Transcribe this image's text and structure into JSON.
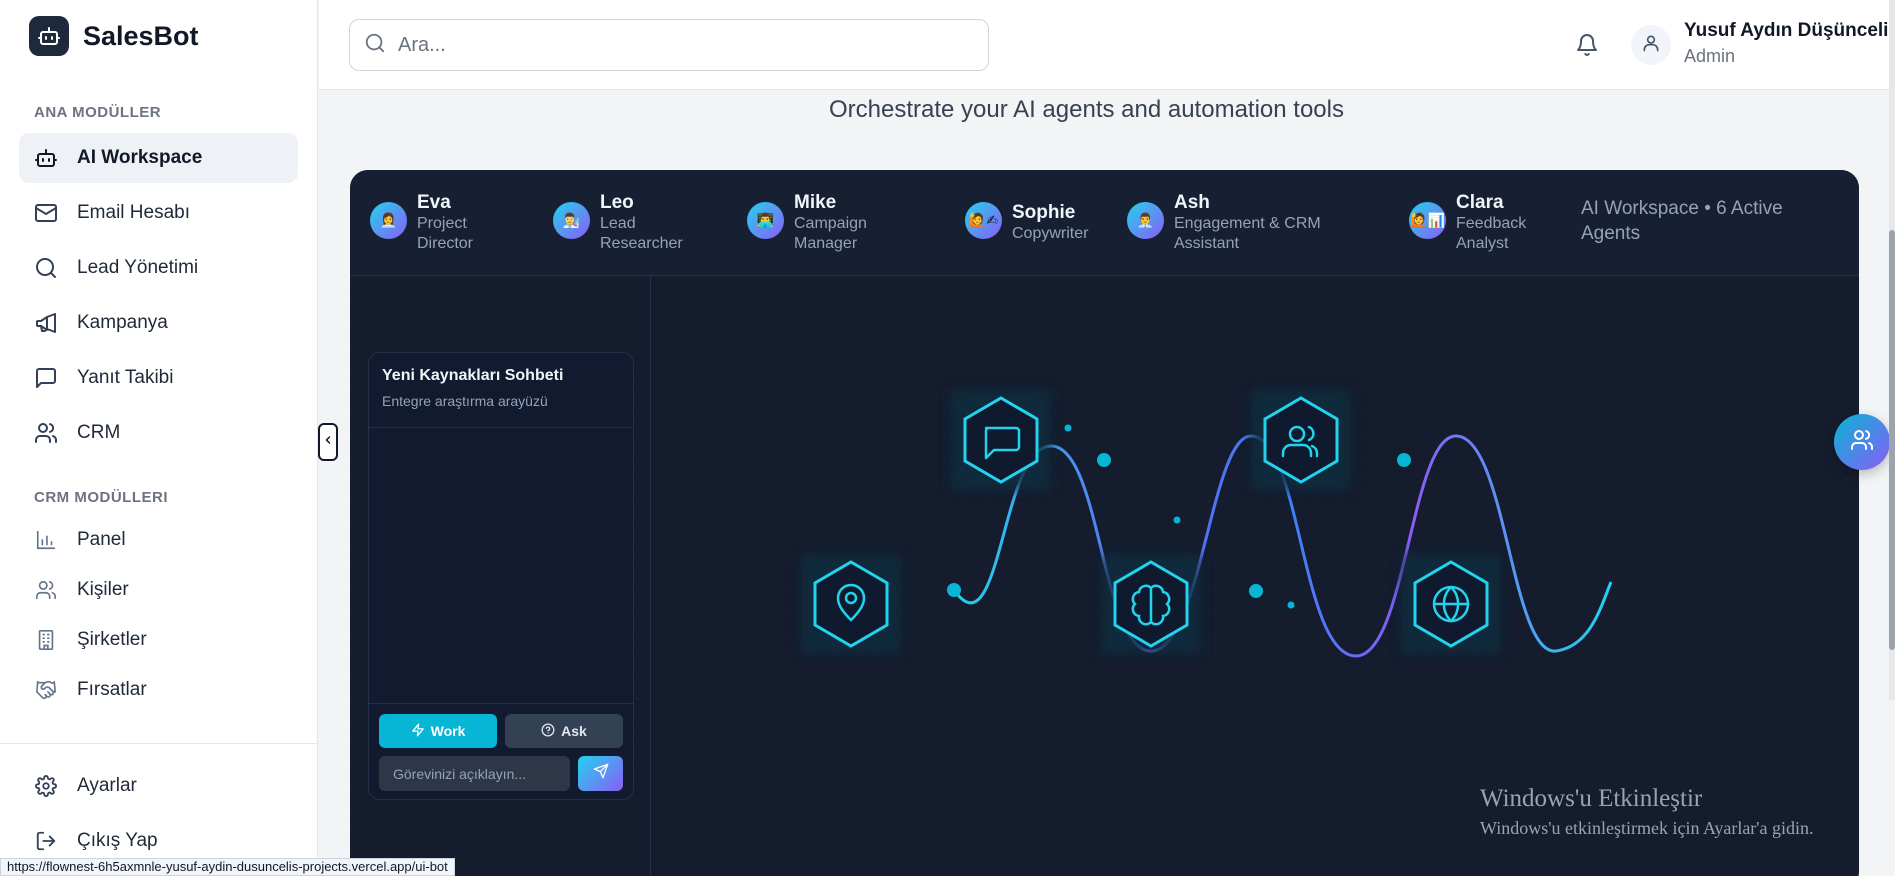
{
  "brand": {
    "name": "SalesBot"
  },
  "sidebar": {
    "section_main": "ANA MODÜLLER",
    "main_items": [
      {
        "label": "AI Workspace",
        "icon": "bot-icon",
        "active": true
      },
      {
        "label": "Email Hesabı",
        "icon": "mail-icon"
      },
      {
        "label": "Lead Yönetimi",
        "icon": "search-icon"
      },
      {
        "label": "Kampanya",
        "icon": "megaphone-icon"
      },
      {
        "label": "Yanıt Takibi",
        "icon": "message-icon"
      },
      {
        "label": "CRM",
        "icon": "users-icon"
      }
    ],
    "section_crm": "CRM MODÜLLERI",
    "crm_items": [
      {
        "label": "Panel",
        "icon": "bar-chart-icon"
      },
      {
        "label": "Kişiler",
        "icon": "users-icon"
      },
      {
        "label": "Şirketler",
        "icon": "building-icon"
      },
      {
        "label": "Fırsatlar",
        "icon": "handshake-icon"
      }
    ],
    "footer_items": [
      {
        "label": "Ayarlar",
        "icon": "gear-icon"
      },
      {
        "label": "Çıkış Yap",
        "icon": "logout-icon"
      }
    ]
  },
  "header": {
    "search_placeholder": "Ara...",
    "user_name": "Yusuf Aydın Düşünceli",
    "user_role": "Admin"
  },
  "main": {
    "subtitle": "Orchestrate your AI agents and automation tools"
  },
  "workspace": {
    "agents": [
      {
        "name": "Eva",
        "role": "Project Director",
        "emoji": "👩‍💼"
      },
      {
        "name": "Leo",
        "role": "Lead Researcher",
        "emoji": "👨‍🔬"
      },
      {
        "name": "Mike",
        "role": "Campaign Manager",
        "emoji": "👨‍💻"
      },
      {
        "name": "Sophie",
        "role": "Copywriter",
        "emoji": "🙋✍"
      },
      {
        "name": "Ash",
        "role": "Engagement & CRM Assistant",
        "emoji": "👨‍💼"
      },
      {
        "name": "Clara",
        "role": "Feedback Analyst",
        "emoji": "🙋📊"
      }
    ],
    "status": "AI Workspace • 6 Active Agents",
    "chat": {
      "title": "Yeni Kaynakları Sohbeti",
      "subtitle": "Entegre araştırma arayüzü",
      "work_label": "Work",
      "ask_label": "Ask",
      "input_placeholder": "Görevinizi açıklayın..."
    },
    "flow_nodes": [
      "location-icon",
      "message-icon",
      "brain-icon",
      "users-icon",
      "globe-icon"
    ],
    "accent_colors": {
      "cyan": "#22d3ee",
      "purple": "#8b5cf6"
    }
  },
  "watermark": {
    "title": "Windows'u Etkinleştir",
    "subtitle": "Windows'u etkinleştirmek için Ayarlar'a gidin."
  },
  "status_url": "https://flownest-6h5axmnle-yusuf-aydin-dusuncelis-projects.vercel.app/ui-bot"
}
